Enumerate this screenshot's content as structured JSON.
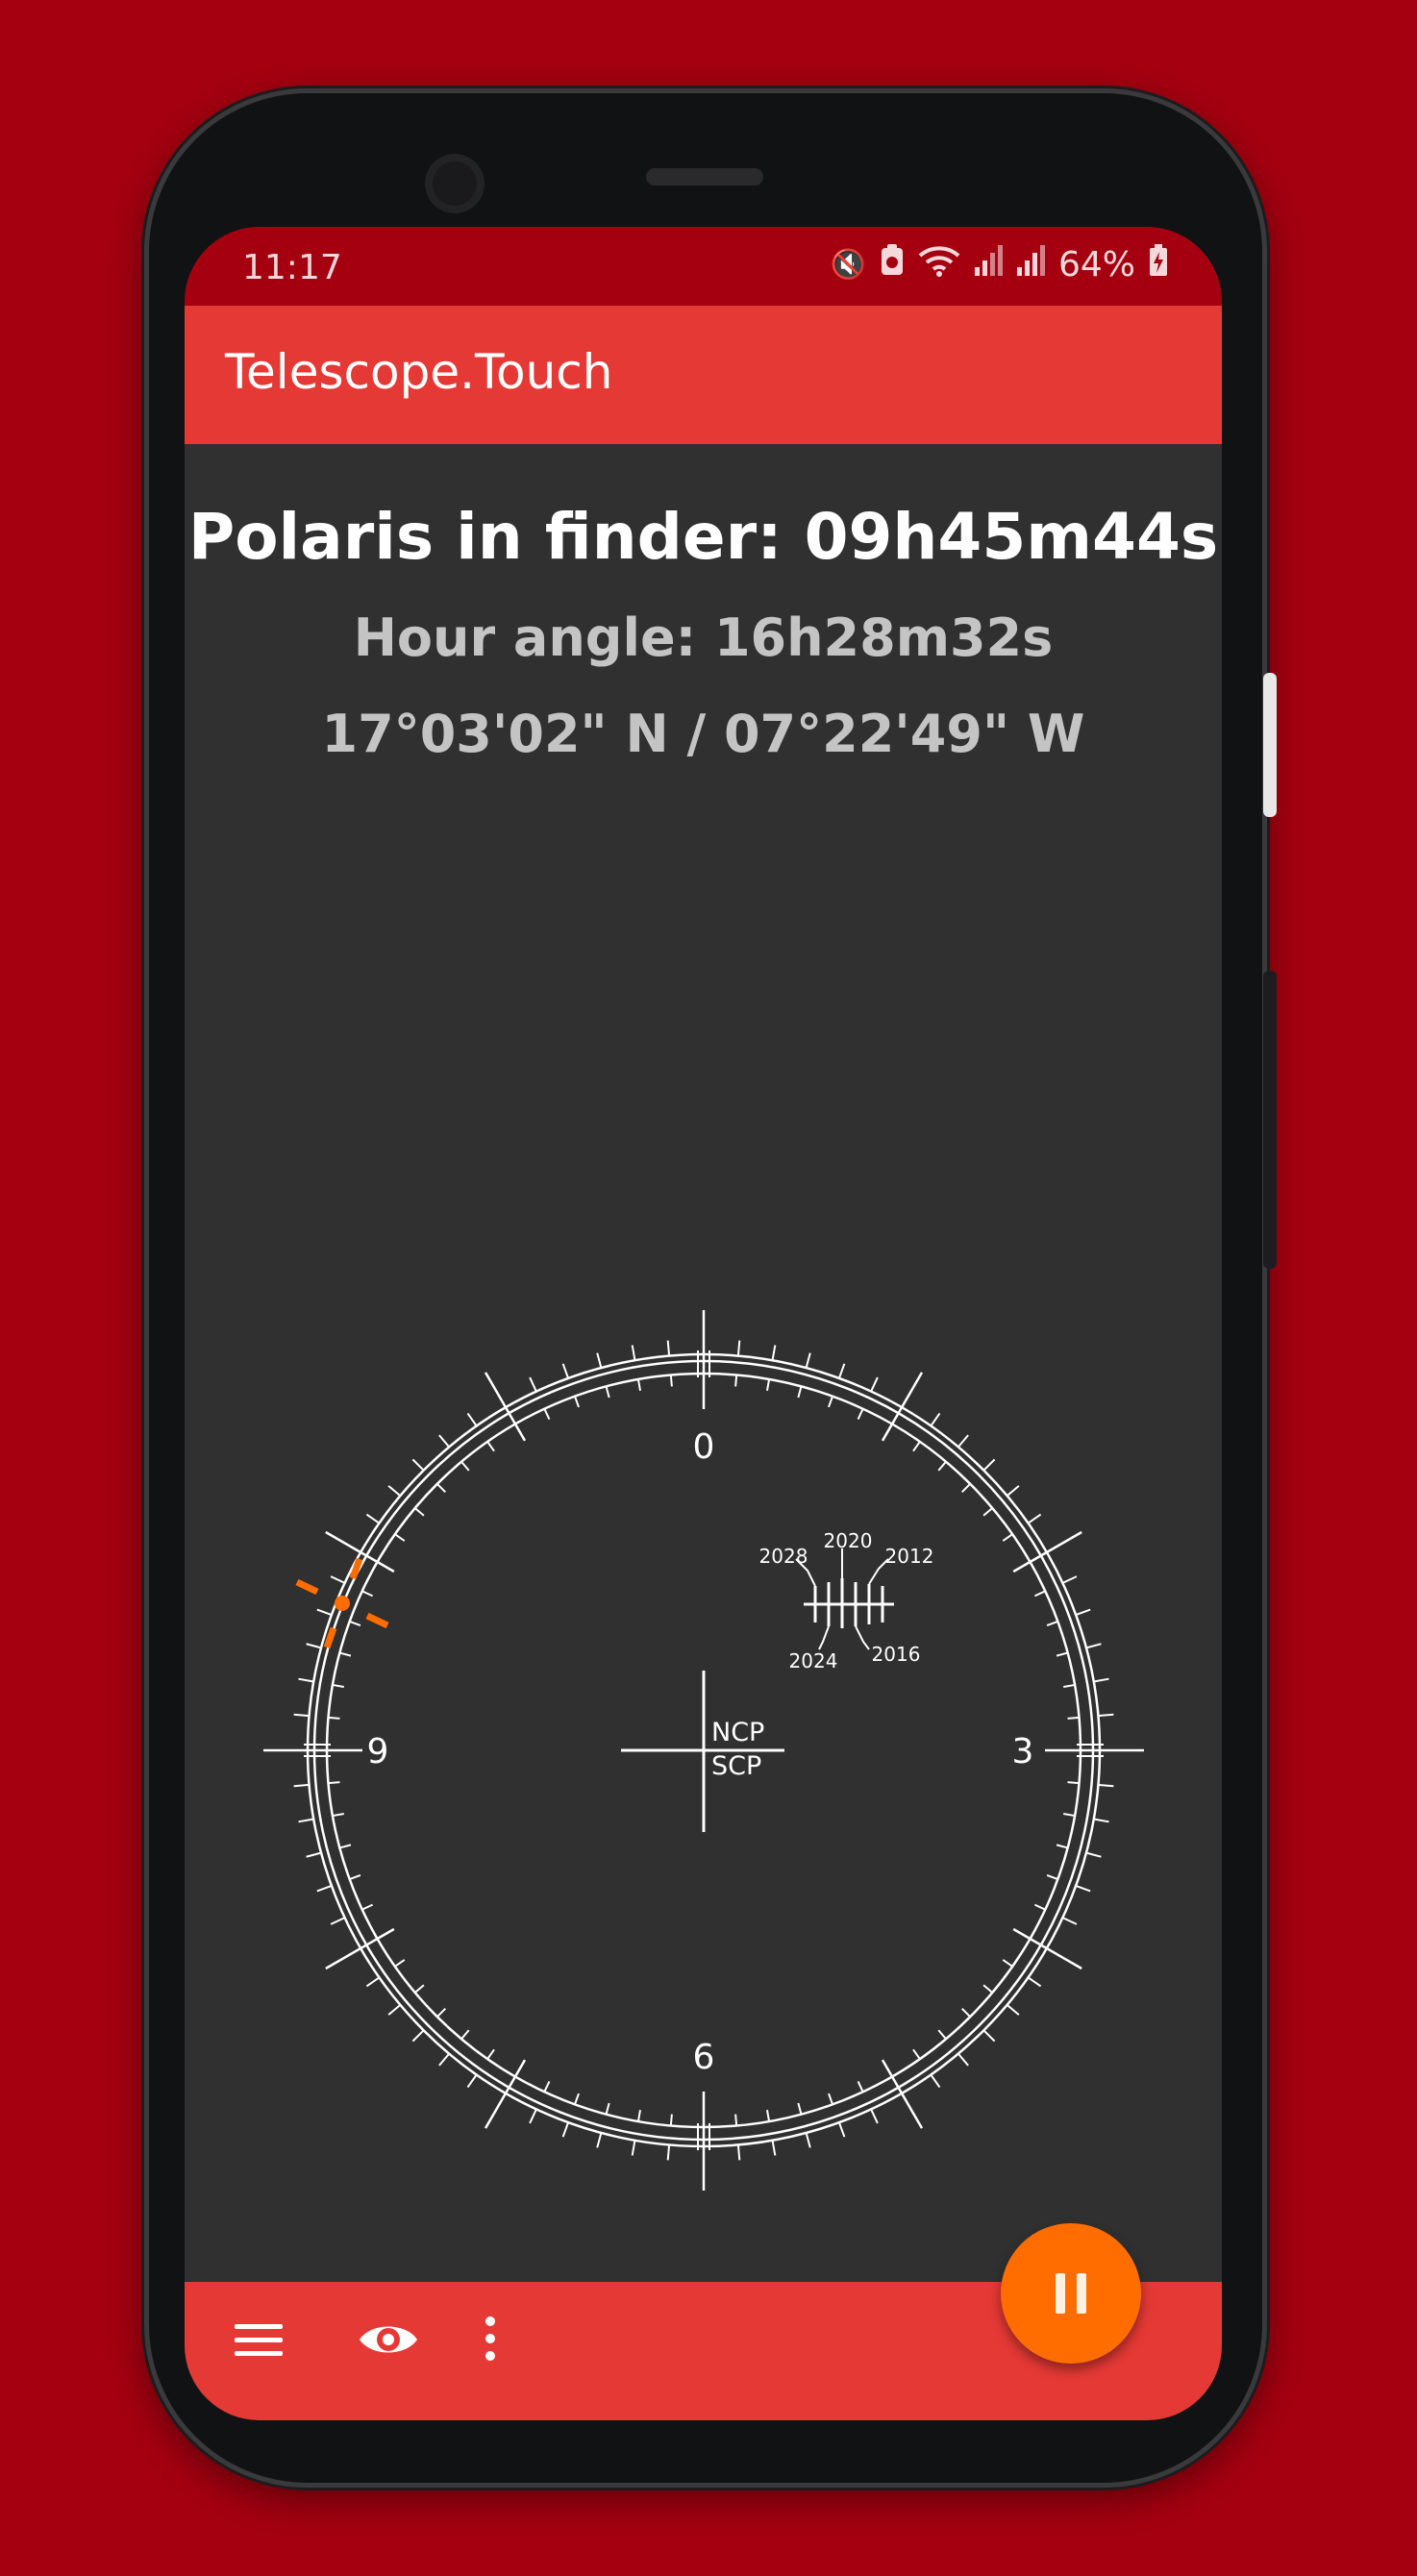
{
  "status_bar": {
    "time": "11:17",
    "battery": "64%",
    "icons": [
      "mute-icon",
      "nfc-icon",
      "wifi-icon",
      "signal-icon",
      "signal-icon",
      "battery-charging-icon"
    ]
  },
  "app_bar": {
    "title": "Telescope.Touch"
  },
  "info": {
    "polaris_in_finder": "Polaris in finder: 09h45m44s",
    "hour_angle": "Hour angle: 16h28m32s",
    "coordinates": "17°03'02\" N / 07°22'49\" W"
  },
  "reticle": {
    "hour_labels": {
      "top": "0",
      "right": "3",
      "bottom": "6",
      "left": "9"
    },
    "center_labels": {
      "upper": "NCP",
      "lower": "SCP"
    },
    "year_labels": [
      "2028",
      "2020",
      "2012",
      "2024",
      "2016"
    ],
    "marker_color": "#ff6d00",
    "line_color": "#ffffff"
  },
  "bottom_bar": {
    "icons": [
      "menu-icon",
      "eye-icon",
      "more-vert-icon"
    ],
    "fab_icon": "pause-icon",
    "accent": "#e53935",
    "fab_color": "#ff6d00"
  }
}
